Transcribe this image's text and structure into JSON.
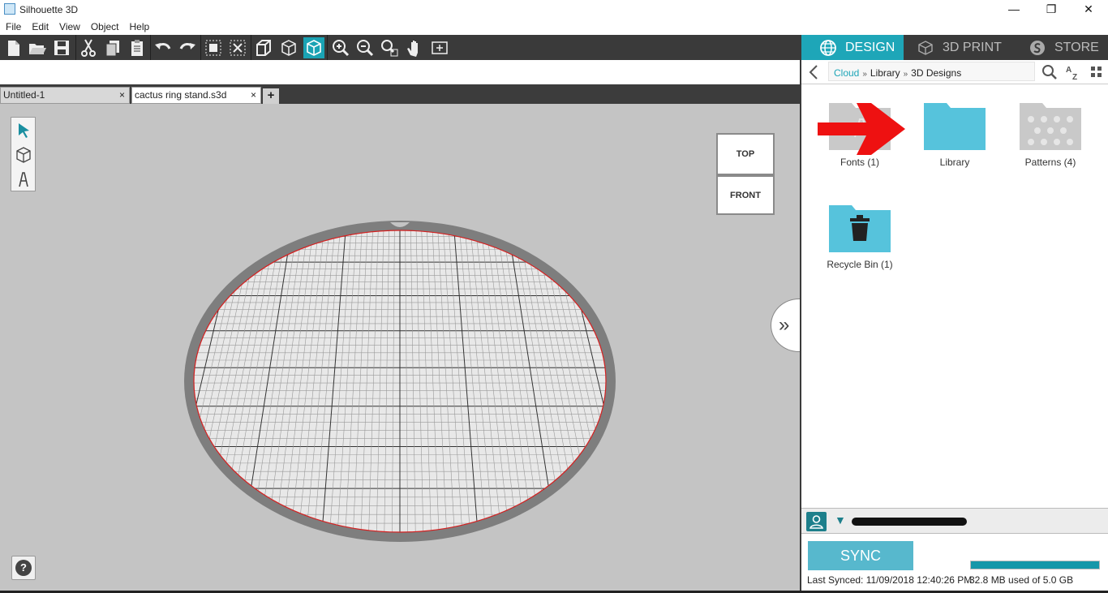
{
  "window": {
    "title": "Silhouette 3D",
    "minimize_glyph": "—",
    "restore_glyph": "❐",
    "close_glyph": "✕"
  },
  "menu": [
    "File",
    "Edit",
    "View",
    "Object",
    "Help"
  ],
  "toolbar": {
    "icons": [
      "new-document-icon",
      "open-folder-icon",
      "save-icon",
      "cut-icon",
      "copy-icon",
      "paste-icon",
      "undo-icon",
      "redo-icon",
      "group-icon",
      "ungroup-icon",
      "extrude-icon",
      "wireframe-cube-icon",
      "solid-cube-icon",
      "zoom-in-icon",
      "zoom-out-icon",
      "zoom-fit-icon",
      "pan-hand-icon",
      "fit-page-icon"
    ],
    "active": "solid-cube-icon"
  },
  "tabs": [
    {
      "label": "Untitled-1",
      "close": "×"
    },
    {
      "label": "cactus ring stand.s3d",
      "close": "×"
    }
  ],
  "tab_add_label": "+",
  "view_cube": {
    "top": "TOP",
    "front": "FRONT"
  },
  "side_tools": [
    "select-arrow-icon",
    "3d-shape-icon",
    "text-tool-icon"
  ],
  "help_label": "?",
  "expand_label": "»",
  "panel": {
    "tabs": [
      {
        "label": "DESIGN",
        "icon": "globe-icon",
        "active": true
      },
      {
        "label": "3D PRINT",
        "icon": "3d-print-icon",
        "active": false
      },
      {
        "label": "STORE",
        "icon": "store-s-icon",
        "active": false
      }
    ],
    "breadcrumb": [
      "Cloud",
      "Library",
      "3D Designs"
    ],
    "breadcrumb_separator": "»",
    "folders": [
      {
        "label": "Fonts (1)",
        "color": "#c9c9c9",
        "icon": "fonts-folder-icon"
      },
      {
        "label": "Library",
        "color": "#56c3dc",
        "icon": "library-folder-icon"
      },
      {
        "label": "Patterns (4)",
        "color": "#c9c9c9",
        "icon": "patterns-folder-icon"
      },
      {
        "label": "Recycle Bin (1)",
        "color": "#56c3dc",
        "icon": "recycle-bin-folder-icon"
      }
    ],
    "sync_label": "SYNC",
    "last_synced": "Last Synced: 11/09/2018 12:40:26 PM",
    "storage_text": "32.8 MB used of 5.0 GB",
    "storage_fraction": 0.0066
  },
  "colors": {
    "accent": "#1ea6b8",
    "toolbar_bg": "#3a3a3a",
    "canvas_bg": "#c4c4c4",
    "annotation_arrow": "#ee1111"
  }
}
